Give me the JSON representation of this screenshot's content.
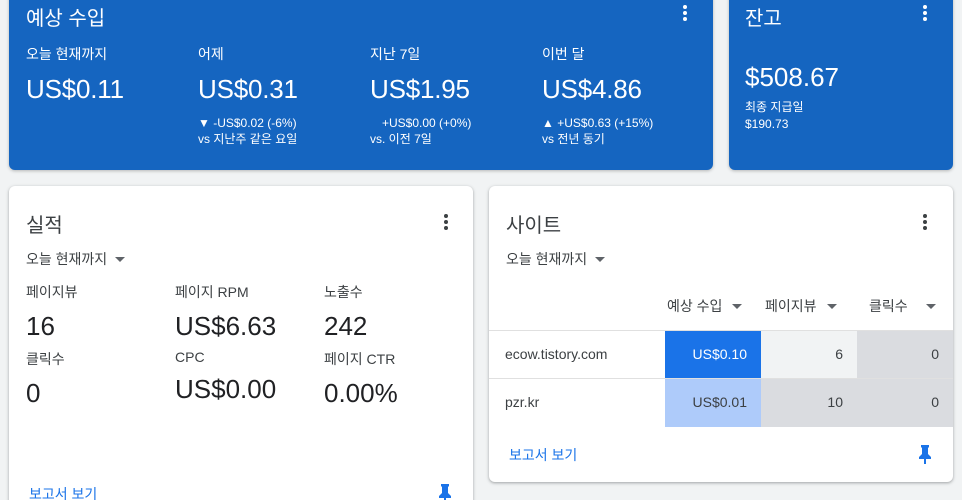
{
  "earnings": {
    "title": "예상 수입",
    "metrics": [
      {
        "label": "오늘 현재까지",
        "value": "US$0.11",
        "delta": "",
        "compare": ""
      },
      {
        "label": "어제",
        "value": "US$0.31",
        "delta": "▼ -US$0.02 (-6%)",
        "compare": "vs 지난주 같은 요일"
      },
      {
        "label": "지난 7일",
        "value": "US$1.95",
        "delta": "+US$0.00 (+0%)",
        "compare": "vs. 이전 7일"
      },
      {
        "label": "이번 달",
        "value": "US$4.86",
        "delta": "▲ +US$0.63 (+15%)",
        "compare": "vs 전년 동기"
      }
    ]
  },
  "balance": {
    "title": "잔고",
    "value": "$508.67",
    "last_payment_label": "최종 지급일",
    "last_payment_value": "$190.73"
  },
  "performance": {
    "title": "실적",
    "range": "오늘 현재까지",
    "metrics": [
      {
        "label": "페이지뷰",
        "value": "16"
      },
      {
        "label": "페이지 RPM",
        "value": "US$6.63"
      },
      {
        "label": "노출수",
        "value": "242"
      },
      {
        "label": "클릭수",
        "value": "0"
      },
      {
        "label": "CPC",
        "value": "US$0.00"
      },
      {
        "label": "페이지 CTR",
        "value": "0.00%"
      }
    ],
    "report_link": "보고서 보기"
  },
  "sites": {
    "title": "사이트",
    "range": "오늘 현재까지",
    "columns": [
      "예상 수입",
      "페이지뷰",
      "클릭수"
    ],
    "rows": [
      {
        "site": "ecow.tistory.com",
        "earnings": "US$0.10",
        "pageviews": "6",
        "clicks": "0"
      },
      {
        "site": "pzr.kr",
        "earnings": "US$0.01",
        "pageviews": "10",
        "clicks": "0"
      }
    ],
    "report_link": "보고서 보기"
  },
  "colors": {
    "card_blue": "#1565c0",
    "link_blue": "#1a73e8",
    "heat_high": "#1a73e8",
    "heat_low": "#aecbfa",
    "heat_neutral": "#dadce0"
  },
  "icons": [
    "more-vert-icon",
    "dropdown-caret-icon",
    "pin-icon"
  ]
}
